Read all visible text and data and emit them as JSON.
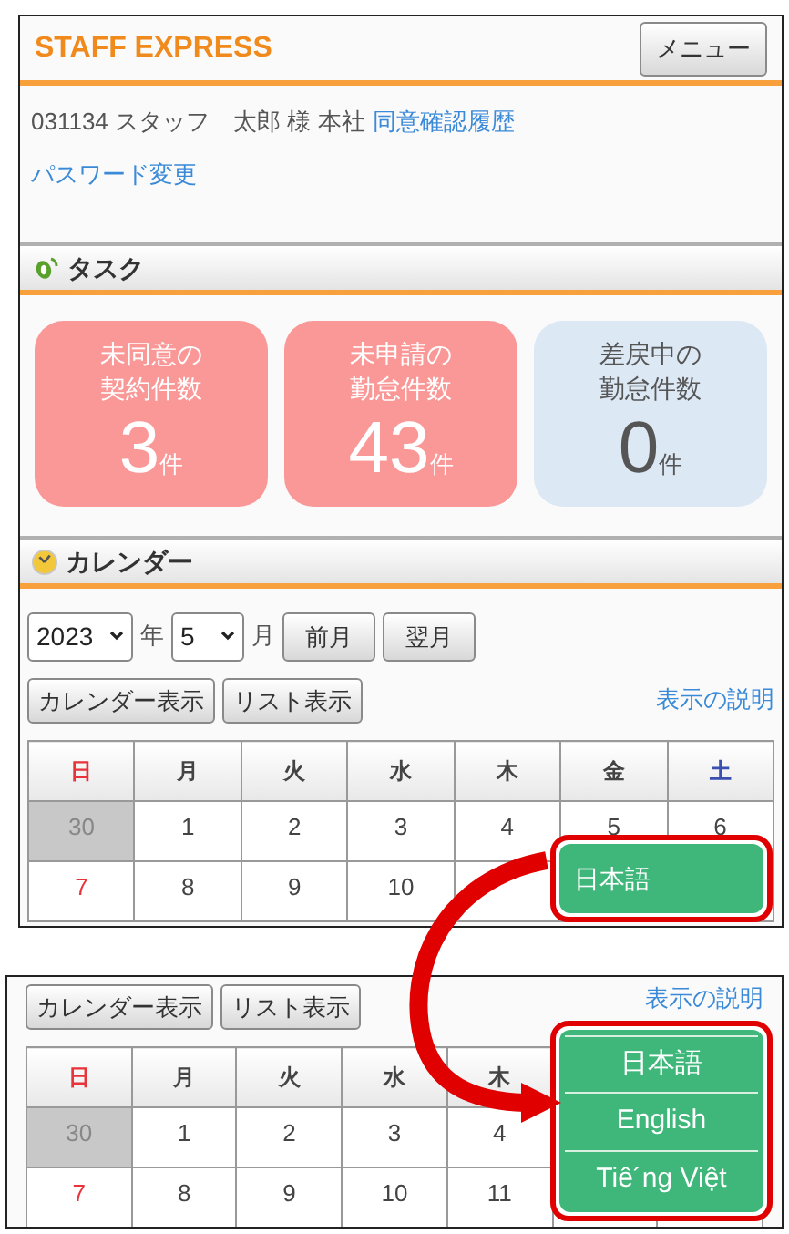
{
  "top_screen": {
    "header": {
      "logo": "STAFF EXPRESS",
      "menu_button": "メニュー"
    },
    "user_info": {
      "text": "031134 スタッフ　太郎 様 本社",
      "link": "同意確認履歴"
    },
    "password_link": "パスワード変更",
    "tasks": {
      "title": "タスク",
      "cards": [
        {
          "lines": [
            "未同意の",
            "契約件数"
          ],
          "count": "3",
          "unit": "件",
          "kind": "alert"
        },
        {
          "lines": [
            "未申請の",
            "勤怠件数"
          ],
          "count": "43",
          "unit": "件",
          "kind": "alert"
        },
        {
          "lines": [
            "差戻中の",
            "勤怠件数"
          ],
          "count": "0",
          "unit": "件",
          "kind": "normal"
        }
      ]
    },
    "calendar": {
      "title": "カレンダー",
      "year": "2023",
      "year_unit": "年",
      "month": "5",
      "month_unit": "月",
      "nav_buttons": [
        "前月",
        "翌月"
      ],
      "view_buttons": [
        "カレンダー表示",
        "リスト表示"
      ],
      "help_link": "表示の説明",
      "weekdays": [
        {
          "label": "日",
          "kind": "sunday"
        },
        {
          "label": "月",
          "kind": "weekday"
        },
        {
          "label": "火",
          "kind": "weekday"
        },
        {
          "label": "水",
          "kind": "weekday"
        },
        {
          "label": "木",
          "kind": "weekday"
        },
        {
          "label": "金",
          "kind": "weekday"
        },
        {
          "label": "土",
          "kind": "saturday"
        }
      ],
      "weeks": [
        [
          {
            "day": "30",
            "kind": "outside"
          },
          {
            "day": "1",
            "kind": "normal"
          },
          {
            "day": "2",
            "kind": "normal"
          },
          {
            "day": "3",
            "kind": "normal"
          },
          {
            "day": "4",
            "kind": "normal"
          },
          {
            "day": "5",
            "kind": "normal"
          },
          {
            "day": "6",
            "kind": "normal"
          }
        ],
        [
          {
            "day": "7",
            "kind": "sunday"
          },
          {
            "day": "8",
            "kind": "normal"
          },
          {
            "day": "9",
            "kind": "normal"
          },
          {
            "day": "10",
            "kind": "normal"
          }
        ]
      ]
    },
    "language_button": "日本語"
  },
  "bottom_screen": {
    "view_buttons": [
      "カレンダー表示",
      "リスト表示"
    ],
    "help_link": "表示の説明",
    "weekdays": [
      {
        "label": "日",
        "kind": "sunday"
      },
      {
        "label": "月",
        "kind": "weekday"
      },
      {
        "label": "火",
        "kind": "weekday"
      },
      {
        "label": "水",
        "kind": "weekday"
      },
      {
        "label": "木",
        "kind": "weekday"
      }
    ],
    "weeks": [
      [
        {
          "day": "30",
          "kind": "outside"
        },
        {
          "day": "1",
          "kind": "normal"
        },
        {
          "day": "2",
          "kind": "normal"
        },
        {
          "day": "3",
          "kind": "normal"
        },
        {
          "day": "4",
          "kind": "normal"
        }
      ],
      [
        {
          "day": "7",
          "kind": "sunday"
        },
        {
          "day": "8",
          "kind": "normal"
        },
        {
          "day": "9",
          "kind": "normal"
        },
        {
          "day": "10",
          "kind": "normal"
        },
        {
          "day": "11",
          "kind": "normal"
        }
      ]
    ],
    "language_menu": [
      "日本語",
      "English",
      "Tiê´ng Việt"
    ]
  }
}
